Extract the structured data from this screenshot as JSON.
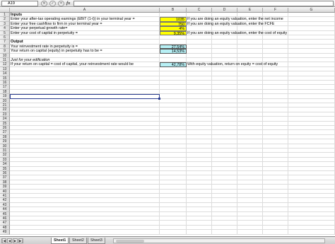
{
  "formula_bar": {
    "name_box": "A19",
    "fx_label": "fx",
    "formula": ""
  },
  "columns": [
    "A",
    "B",
    "C",
    "D",
    "E",
    "F",
    "G"
  ],
  "rows": [
    {
      "n": "1",
      "a": "Inputs",
      "a_style": "bold"
    },
    {
      "n": "2",
      "a": "Enter your after-tax operating earnings (EBIT (1-t)) in your terminal year =",
      "b": "1035",
      "b_style": "yellow",
      "c": "If you are doing an equity valuation, enter the net income"
    },
    {
      "n": "3",
      "a": "Enter your free cashflow to firm in your terminal year =",
      "b": "750",
      "b_style": "yellow",
      "c": "If you are doing an equity valuation, enter the FCFE"
    },
    {
      "n": "4",
      "a": "Enter your perpetual growth rate=",
      "b": "4%",
      "b_style": "yellow"
    },
    {
      "n": "5",
      "a": "Enter your cost of capital in perpetuity =",
      "b": "9,35%",
      "b_style": "yellow",
      "c": "If you are doing an equity valuation, enter the cost of equity"
    },
    {
      "n": "6"
    },
    {
      "n": "7",
      "a": "Output",
      "a_style": "bold"
    },
    {
      "n": "8",
      "a": "Your reinvestment rate in perpetuity is =",
      "b": "27,54%",
      "b_style": "cyan"
    },
    {
      "n": "9",
      "a": "Your return on capital (equity) in perpetuity has to be =",
      "b": "14,53%",
      "b_style": "cyan"
    },
    {
      "n": "10"
    },
    {
      "n": "11",
      "a": "Just for your edification",
      "a_style": "ital"
    },
    {
      "n": "12",
      "a": "If your return on capital = cost of capital, your reinvestment rate would be",
      "b": "42,78%",
      "b_style": "cyan",
      "c": "With equity valuation, return on equity = cost of equity"
    },
    {
      "n": "13"
    },
    {
      "n": "14"
    },
    {
      "n": "15"
    },
    {
      "n": "16"
    },
    {
      "n": "17"
    },
    {
      "n": "18"
    },
    {
      "n": "19"
    },
    {
      "n": "20"
    },
    {
      "n": "21"
    },
    {
      "n": "22"
    },
    {
      "n": "23"
    },
    {
      "n": "24"
    },
    {
      "n": "25"
    },
    {
      "n": "26"
    },
    {
      "n": "27"
    },
    {
      "n": "28"
    },
    {
      "n": "29"
    },
    {
      "n": "30"
    },
    {
      "n": "31"
    },
    {
      "n": "32"
    },
    {
      "n": "33"
    },
    {
      "n": "34"
    },
    {
      "n": "35"
    },
    {
      "n": "36"
    },
    {
      "n": "37"
    },
    {
      "n": "38"
    },
    {
      "n": "39"
    },
    {
      "n": "40"
    },
    {
      "n": "41"
    },
    {
      "n": "42"
    },
    {
      "n": "43"
    },
    {
      "n": "44"
    },
    {
      "n": "45"
    },
    {
      "n": "46"
    },
    {
      "n": "47"
    },
    {
      "n": "48"
    },
    {
      "n": "49"
    }
  ],
  "selected_row": "19",
  "sheet_tabs": [
    {
      "label": "Sheet1",
      "active": true
    },
    {
      "label": "Sheet2",
      "active": false
    },
    {
      "label": "Sheet3",
      "active": false
    }
  ],
  "colors": {
    "input_fill": "#ffff00",
    "output_fill": "#b7f0f5",
    "selection": "#2a3c8f"
  }
}
